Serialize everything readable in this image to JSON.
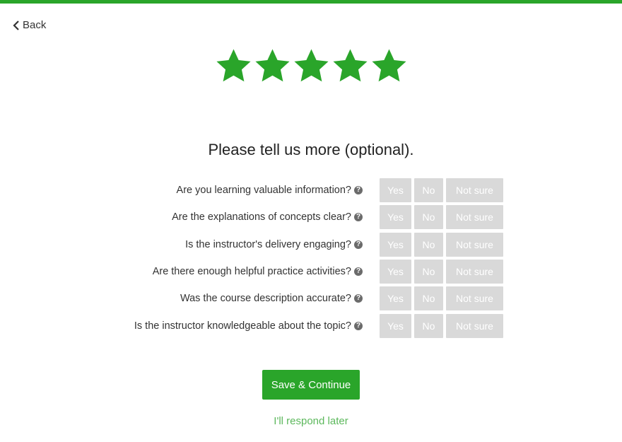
{
  "nav": {
    "back_label": "Back"
  },
  "rating": {
    "value": 5,
    "max": 5,
    "star_color": "#2aa52a"
  },
  "form": {
    "heading": "Please tell us more (optional).",
    "option_labels": {
      "yes": "Yes",
      "no": "No",
      "not_sure": "Not sure"
    },
    "questions": [
      {
        "label": "Are you learning valuable information?"
      },
      {
        "label": "Are the explanations of concepts clear?"
      },
      {
        "label": "Is the instructor's delivery engaging?"
      },
      {
        "label": "Are there enough helpful practice activities?"
      },
      {
        "label": "Was the course description accurate?"
      },
      {
        "label": "Is the instructor knowledgeable about the topic?"
      }
    ]
  },
  "actions": {
    "save_label": "Save & Continue",
    "later_label": "I'll respond later"
  },
  "colors": {
    "accent": "#2aa52a",
    "option_bg": "#d9d9d9",
    "link": "#5cb85c"
  },
  "icons": {
    "back": "chevron-left-icon",
    "star": "star-icon",
    "help": "question-circle-icon"
  }
}
